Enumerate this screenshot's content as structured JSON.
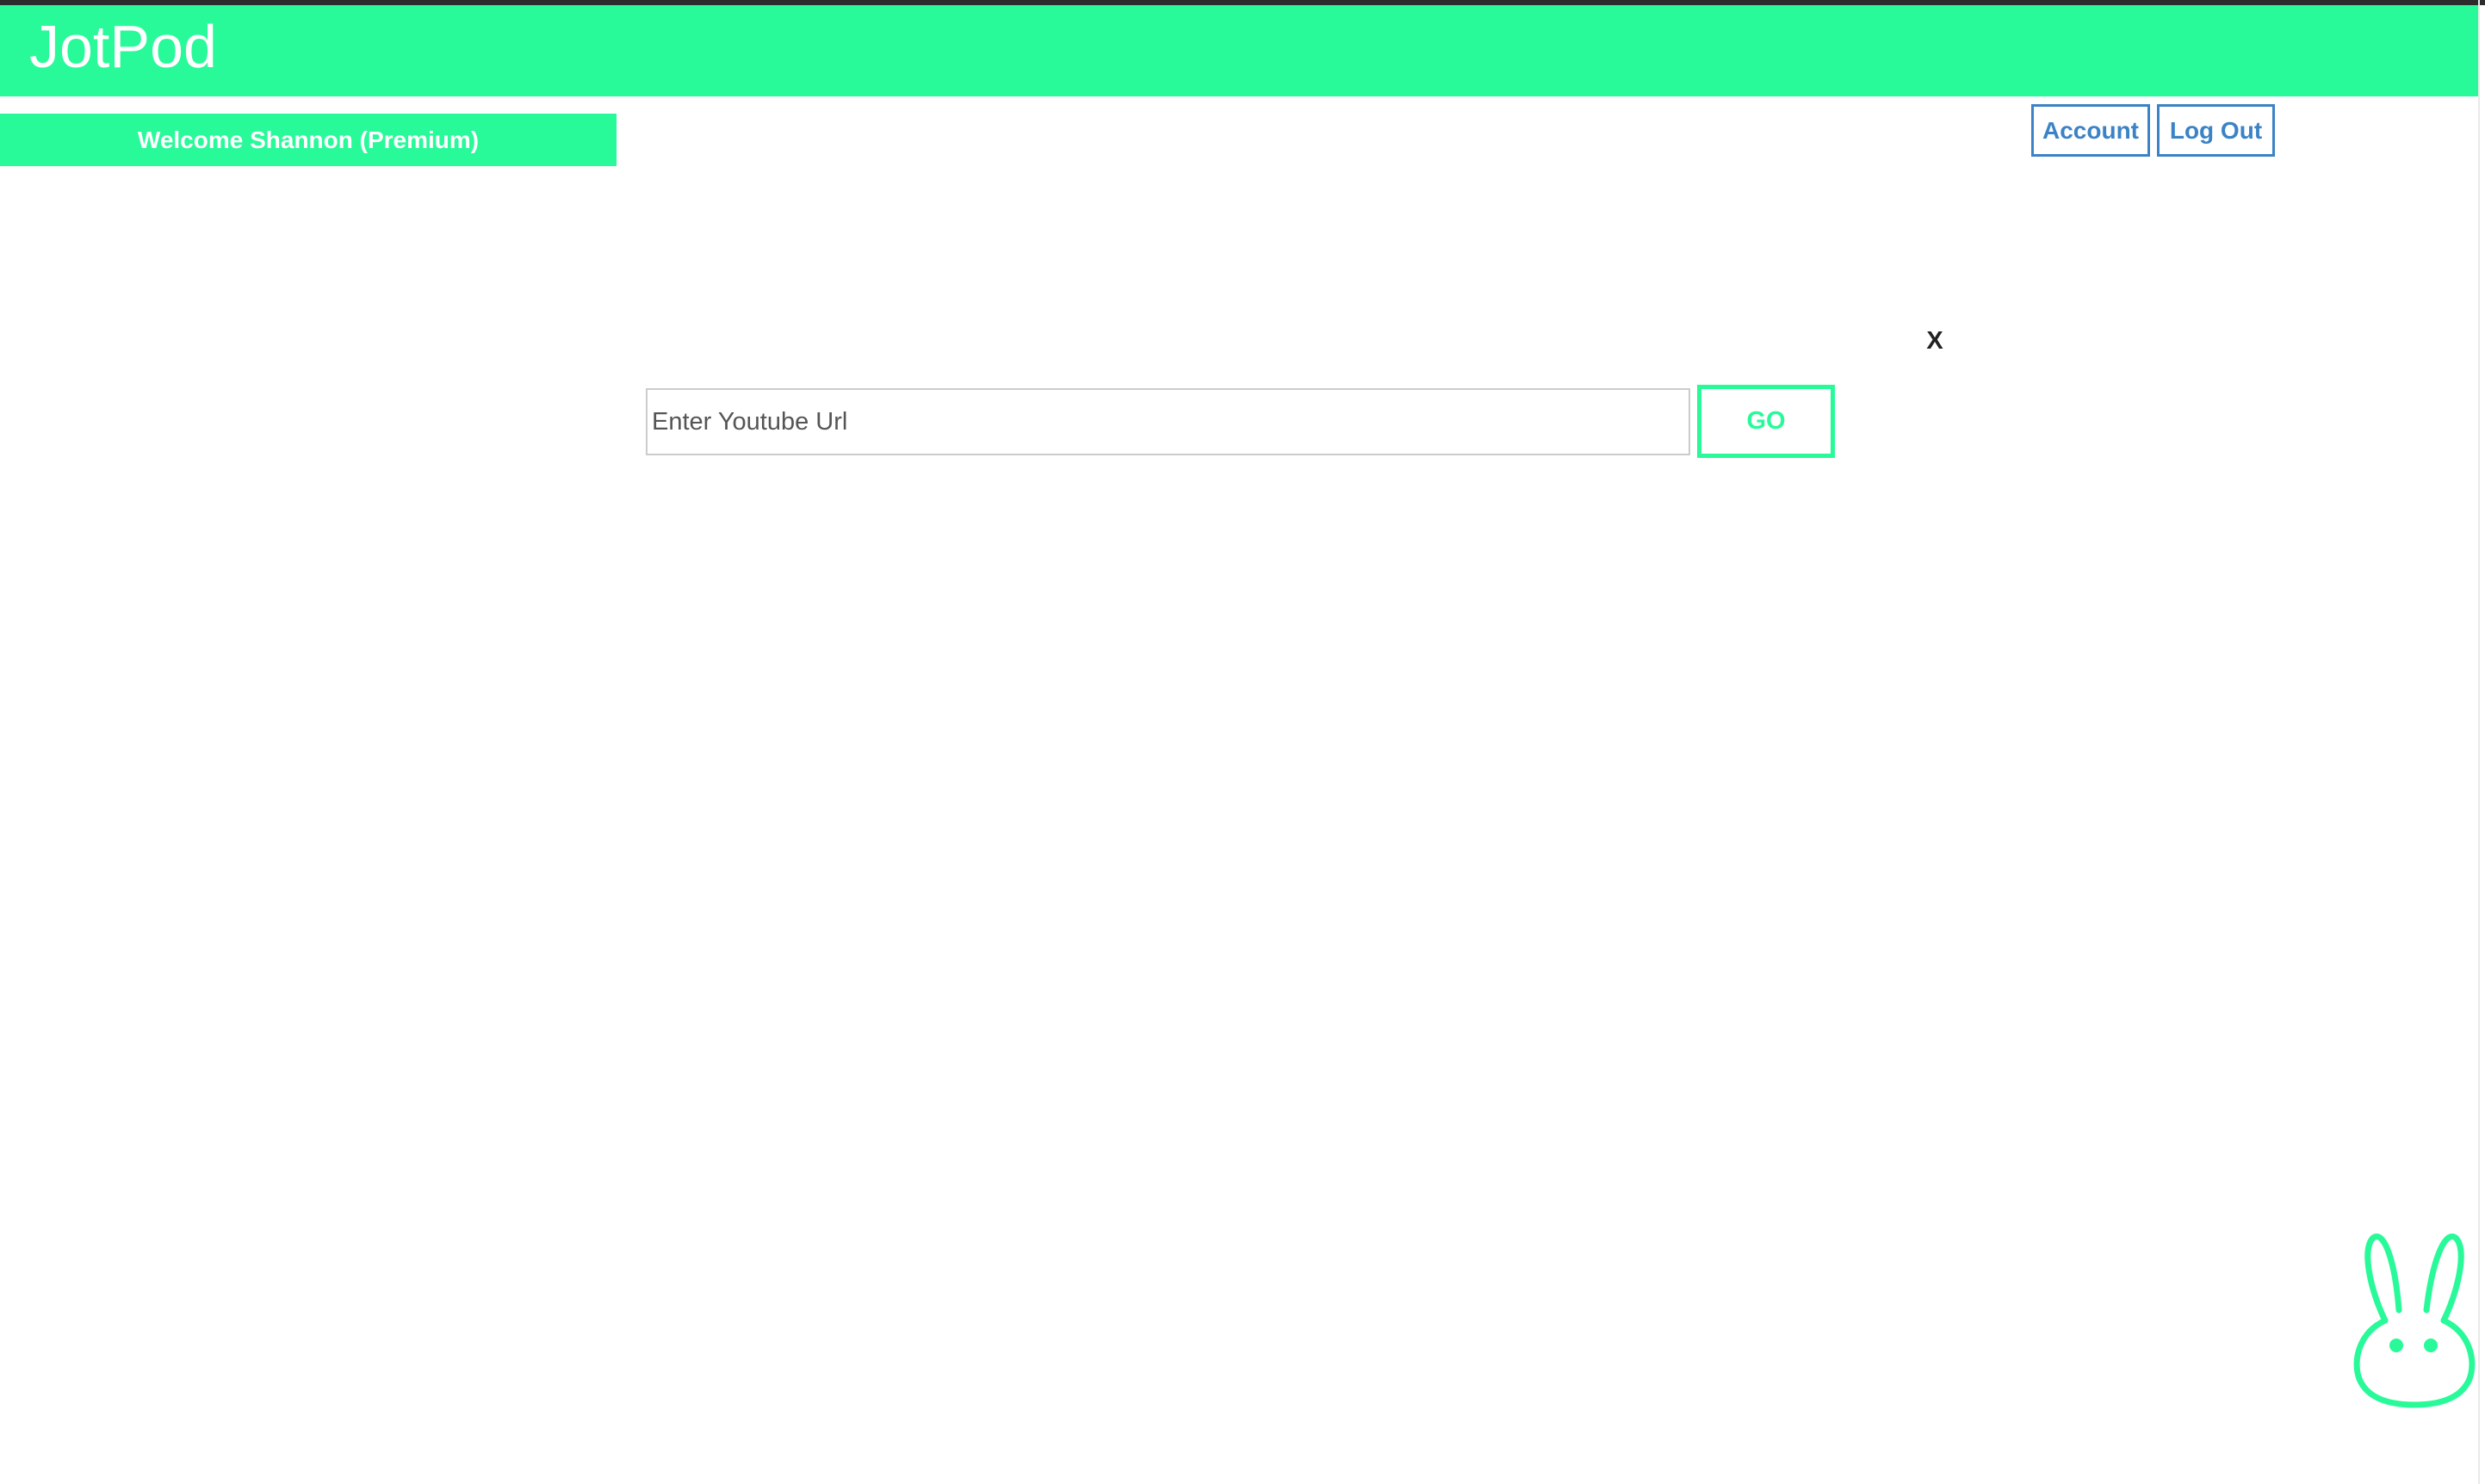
{
  "header": {
    "logo_text": "JotPod"
  },
  "user": {
    "welcome_text": "Welcome Shannon (Premium)"
  },
  "nav": {
    "account_label": "Account",
    "logout_label": "Log Out"
  },
  "modal": {
    "close_label": "X",
    "url_input_value": "",
    "url_input_placeholder": "Enter Youtube Url",
    "go_label": "GO"
  },
  "mascot": {
    "icon": "bunny-icon"
  },
  "colors": {
    "brand_green": "#28fa99",
    "link_blue": "#3b83c6",
    "background": "#ffffff"
  }
}
